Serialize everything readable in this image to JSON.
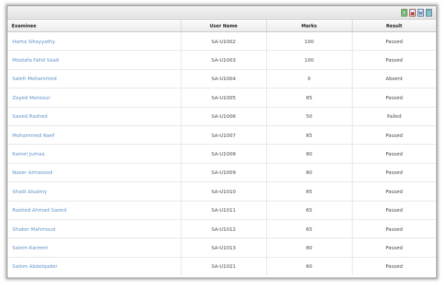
{
  "toolbar": {
    "icons": [
      "excel-export-icon",
      "pdf-export-icon",
      "word-export-icon",
      "csv-export-icon"
    ]
  },
  "table": {
    "columns": [
      "Examinee",
      "User Name",
      "Marks",
      "Result"
    ],
    "rows": [
      {
        "examinee": "Hama Ghayyathy",
        "user_name": "SA-U1002",
        "marks": "100",
        "result": "Passed"
      },
      {
        "examinee": "Mostafa Fahd Saad",
        "user_name": "SA-U1003",
        "marks": "100",
        "result": "Passed"
      },
      {
        "examinee": "Saleh Mohammed",
        "user_name": "SA-U1004",
        "marks": "0",
        "result": "Absent"
      },
      {
        "examinee": "Zayed Mansour",
        "user_name": "SA-U1005",
        "marks": "85",
        "result": "Passed"
      },
      {
        "examinee": "Saeed Rashed",
        "user_name": "SA-U1006",
        "marks": "50",
        "result": "Failed"
      },
      {
        "examinee": "Mohammed Naef",
        "user_name": "SA-U1007",
        "marks": "85",
        "result": "Passed"
      },
      {
        "examinee": "Kamel Jumaa",
        "user_name": "SA-U1008",
        "marks": "80",
        "result": "Passed"
      },
      {
        "examinee": "Naser Almasood",
        "user_name": "SA-U1009",
        "marks": "80",
        "result": "Passed"
      },
      {
        "examinee": "Shadi Alsalmy",
        "user_name": "SA-U1010",
        "marks": "85",
        "result": "Passed"
      },
      {
        "examinee": "Rashed Ahmad Saeed",
        "user_name": "SA-U1011",
        "marks": "65",
        "result": "Passed"
      },
      {
        "examinee": "Shaker Mahmoud",
        "user_name": "SA-U1012",
        "marks": "65",
        "result": "Passed"
      },
      {
        "examinee": "Salem Kareem",
        "user_name": "SA-U1013",
        "marks": "80",
        "result": "Passed"
      },
      {
        "examinee": "Salem Abdelqader",
        "user_name": "SA-U1021",
        "marks": "60",
        "result": "Passed"
      }
    ]
  },
  "colors": {
    "link": "#5b8fc7",
    "header_bg": "#ececec",
    "border": "#9c9c9c"
  }
}
